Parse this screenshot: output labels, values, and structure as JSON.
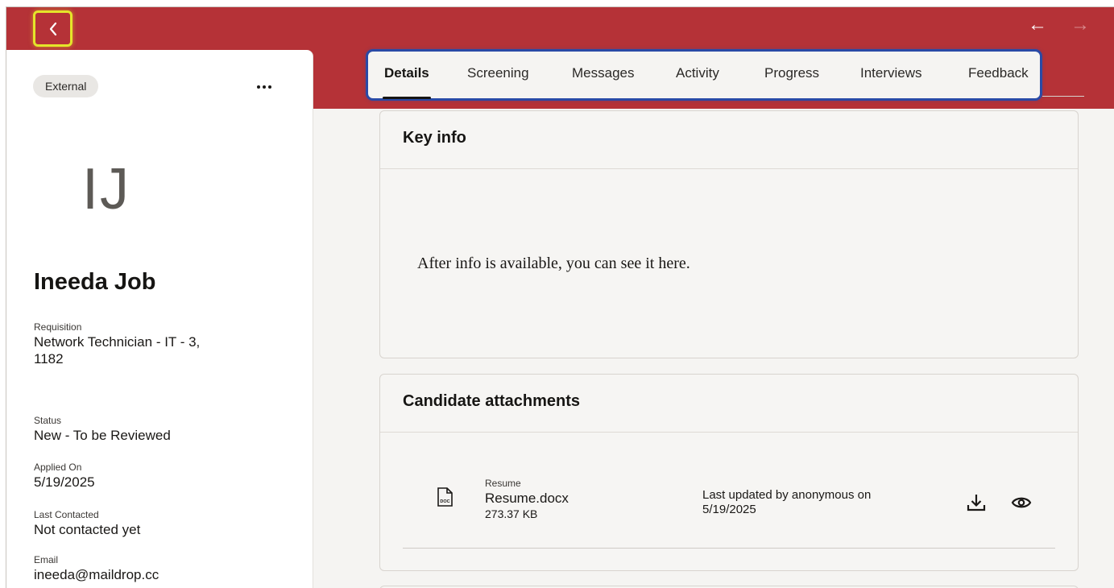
{
  "topbar": {
    "background": "#b53237",
    "back_icon": "chevron-left-icon",
    "prev_icon": "arrow-left-icon",
    "prev_label": "←",
    "next_icon": "arrow-right-icon",
    "next_label": "→"
  },
  "candidate": {
    "source_badge": "External",
    "more_icon": "ellipsis-icon",
    "initials": "IJ",
    "name": "Ineeda Job",
    "fields": [
      {
        "label": "Requisition",
        "value": "Network Technician - IT - 3,",
        "value2": "1182"
      },
      {
        "label": "Status",
        "value": "New - To be Reviewed"
      },
      {
        "label": "Applied On",
        "value": "5/19/2025"
      },
      {
        "label": "Last Contacted",
        "value": "Not contacted yet"
      },
      {
        "label": "Email",
        "value": "ineeda@maildrop.cc"
      }
    ]
  },
  "tabs": [
    {
      "label": "Details",
      "active": true
    },
    {
      "label": "Screening"
    },
    {
      "label": "Messages"
    },
    {
      "label": "Activity"
    },
    {
      "label": "Progress"
    },
    {
      "label": "Interviews"
    },
    {
      "label": "Feedback"
    }
  ],
  "key_info": {
    "title": "Key info",
    "empty_message": "After info is available, you can see it here."
  },
  "attachments": {
    "title": "Candidate attachments",
    "items": [
      {
        "file_icon": "doc-file-icon",
        "icon_text": "DOC",
        "type": "Resume",
        "name": "Resume.docx",
        "size": "273.37 KB",
        "updated_line1": "Last updated by anonymous on",
        "updated_line2": "5/19/2025",
        "download_icon": "download-icon",
        "view_icon": "eye-icon"
      }
    ]
  }
}
